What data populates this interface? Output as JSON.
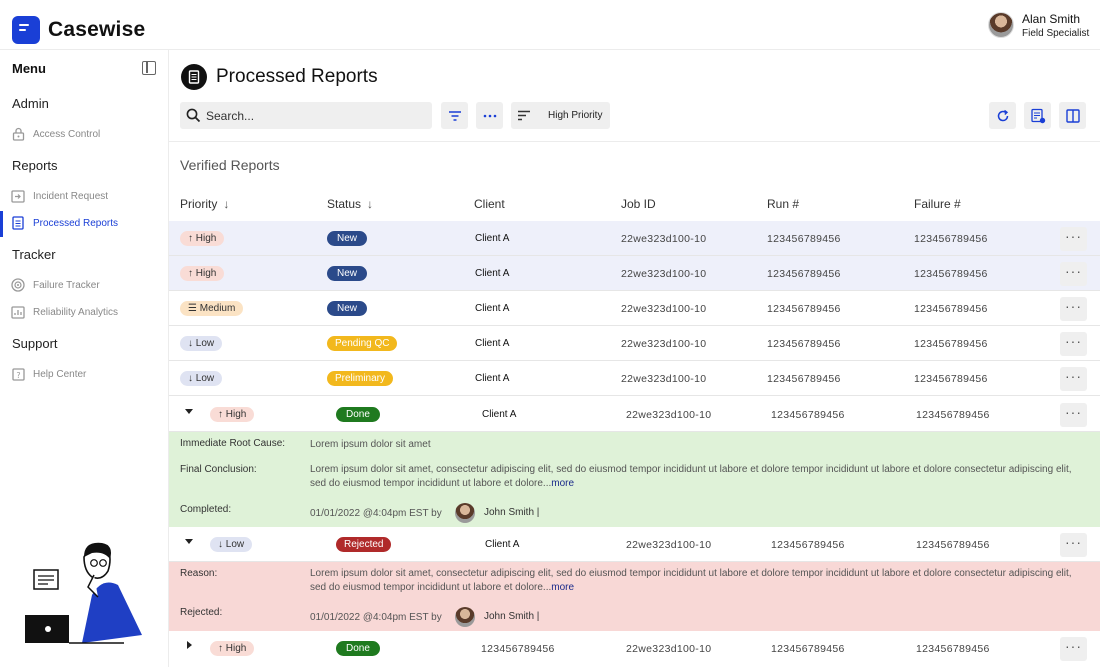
{
  "app": {
    "name": "Casewise",
    "accent": "#1a3fd6"
  },
  "user": {
    "name": "Alan Smith",
    "role": "Field Specialist"
  },
  "sidebar": {
    "title": "Menu",
    "sections": [
      {
        "label": "Admin",
        "items": [
          {
            "label": "Access Control",
            "icon": "lock-icon"
          }
        ]
      },
      {
        "label": "Reports",
        "items": [
          {
            "label": "Incident Request",
            "icon": "inbox-icon"
          },
          {
            "label": "Processed Reports",
            "icon": "document-list-icon",
            "active": true
          }
        ]
      },
      {
        "label": "Tracker",
        "items": [
          {
            "label": "Failure Tracker",
            "icon": "target-icon"
          },
          {
            "label": "Reliability Analytics",
            "icon": "chart-icon"
          }
        ]
      },
      {
        "label": "Support",
        "items": [
          {
            "label": "Help Center",
            "icon": "help-icon"
          }
        ]
      }
    ]
  },
  "page": {
    "title": "Processed Reports",
    "section_title": "Verified Reports"
  },
  "toolbar": {
    "search_placeholder": "Search...",
    "sort_value": "High Priority"
  },
  "table": {
    "columns": [
      "Priority",
      "Status",
      "Client",
      "Job ID",
      "Run #",
      "Failure #"
    ],
    "sort_arrow": "↓",
    "more_glyph": "···",
    "rows": [
      {
        "priority": "↑ High",
        "status": "New",
        "client": "Client A",
        "job_id": "22we323d100-10",
        "run": "123456789456",
        "failure": "123456789456"
      },
      {
        "priority": "↑ High",
        "status": "New",
        "client": "Client A",
        "job_id": "22we323d100-10",
        "run": "123456789456",
        "failure": "123456789456"
      },
      {
        "priority": "☰ Medium",
        "status": "New",
        "client": "Client A",
        "job_id": "22we323d100-10",
        "run": "123456789456",
        "failure": "123456789456"
      },
      {
        "priority": "↓ Low",
        "status": "Pending QC",
        "client": "Client A",
        "job_id": "22we323d100-10",
        "run": "123456789456",
        "failure": "123456789456"
      },
      {
        "priority": "↓ Low",
        "status": "Preliminary",
        "client": "Client A",
        "job_id": "22we323d100-10",
        "run": "123456789456",
        "failure": "123456789456"
      },
      {
        "priority": "↑ High",
        "status": "Done",
        "client": "Client A",
        "job_id": "22we323d100-10",
        "run": "123456789456",
        "failure": "123456789456"
      },
      {
        "priority": "↓ Low",
        "status": "Rejected",
        "client": "Client A",
        "job_id": "22we323d100-10",
        "run": "123456789456",
        "failure": "123456789456"
      },
      {
        "priority": "↑ High",
        "status": "Done",
        "client": "123456789456",
        "job_id": "22we323d100-10",
        "run": "123456789456",
        "failure": "123456789456"
      }
    ]
  },
  "details": {
    "done": {
      "root_cause_label": "Immediate Root Cause:",
      "root_cause": "Lorem ipsum dolor sit amet",
      "conclusion_label": "Final Conclusion:",
      "conclusion": "Lorem ipsum dolor sit amet, consectetur adipiscing elit, sed do eiusmod tempor incididunt ut labore et dolore  tempor incididunt ut labore et dolore consectetur adipiscing elit, sed do eiusmod tempor incididunt ut labore et dolore...",
      "more": "more",
      "completed_label": "Completed:",
      "completed": "01/01/2022 @4:04pm EST by",
      "by": "John Smith |"
    },
    "rejected": {
      "reason_label": "Reason:",
      "reason": "Lorem ipsum dolor sit amet, consectetur adipiscing elit, sed do eiusmod tempor incididunt ut labore et dolore  tempor incididunt ut labore et dolore consectetur adipiscing elit, sed do eiusmod tempor incididunt ut labore et dolore...",
      "more": "more",
      "rejected_label": "Rejected:",
      "rejected": "01/01/2022 @4:04pm EST by",
      "by": "John Smith |"
    }
  }
}
